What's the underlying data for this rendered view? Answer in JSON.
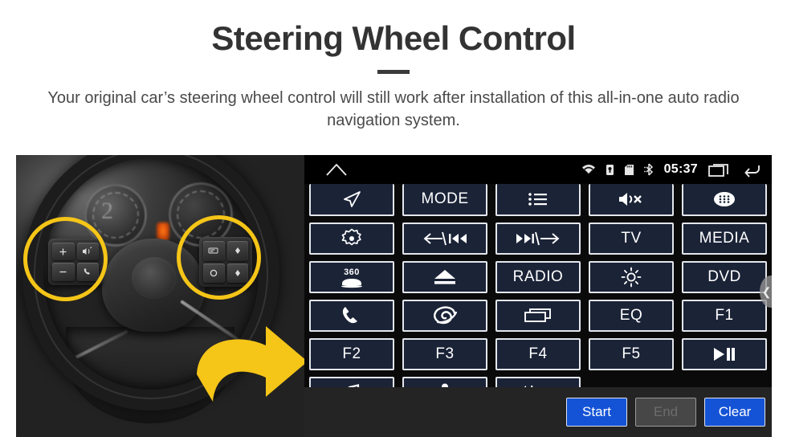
{
  "header": {
    "title": "Steering Wheel Control",
    "subtitle": "Your original car’s steering wheel control will still work after installation of this all-in-one auto radio navigation system."
  },
  "photo": {
    "alt_label": "Car steering wheel with control buttons highlighted",
    "highlight_color": "#f5c518",
    "arrow_color": "#f5c518",
    "gauge_number": "2",
    "left_pad_keys": [
      "+",
      "voice",
      "-",
      "phone"
    ],
    "right_pad_keys": [
      "display",
      "up",
      "circle",
      "down"
    ]
  },
  "head_unit": {
    "statusbar": {
      "home_icon": "home-icon",
      "icons": [
        "wifi-icon",
        "usb-lock-icon",
        "sdcard-icon",
        "bluetooth-icon"
      ],
      "time": "05:37",
      "recents_icon": "recents-icon",
      "back_icon": "back-icon"
    },
    "grid": {
      "columns": 5,
      "buttons": [
        {
          "label": "",
          "icon": "navigation-arrow-icon"
        },
        {
          "label": "MODE",
          "icon": ""
        },
        {
          "label": "",
          "icon": "list-icon"
        },
        {
          "label": "",
          "icon": "mute-icon"
        },
        {
          "label": "",
          "icon": "apps-grid-icon"
        },
        {
          "label": "",
          "icon": "target-icon"
        },
        {
          "label": "",
          "icon": "prev-track-icon"
        },
        {
          "label": "",
          "icon": "next-track-icon"
        },
        {
          "label": "TV",
          "icon": ""
        },
        {
          "label": "MEDIA",
          "icon": ""
        },
        {
          "label": "",
          "icon": "camera-360-icon"
        },
        {
          "label": "",
          "icon": "eject-icon"
        },
        {
          "label": "RADIO",
          "icon": ""
        },
        {
          "label": "",
          "icon": "brightness-icon"
        },
        {
          "label": "DVD",
          "icon": ""
        },
        {
          "label": "",
          "icon": "phone-icon"
        },
        {
          "label": "",
          "icon": "spiral-icon"
        },
        {
          "label": "",
          "icon": "window-icon"
        },
        {
          "label": "EQ",
          "icon": ""
        },
        {
          "label": "F1",
          "icon": ""
        },
        {
          "label": "F2",
          "icon": ""
        },
        {
          "label": "F3",
          "icon": ""
        },
        {
          "label": "F4",
          "icon": ""
        },
        {
          "label": "F5",
          "icon": ""
        },
        {
          "label": "",
          "icon": "play-pause-icon"
        },
        {
          "label": "",
          "icon": "music-note-icon"
        },
        {
          "label": "",
          "icon": "microphone-icon"
        },
        {
          "label": "",
          "icon": "volume-hangup-icon"
        }
      ]
    },
    "scroll_handle_icon": "chevron-left-icon",
    "actions": {
      "start": "Start",
      "end": "End",
      "clear": "Clear",
      "end_disabled": true,
      "accent_color": "#1453d6"
    }
  }
}
